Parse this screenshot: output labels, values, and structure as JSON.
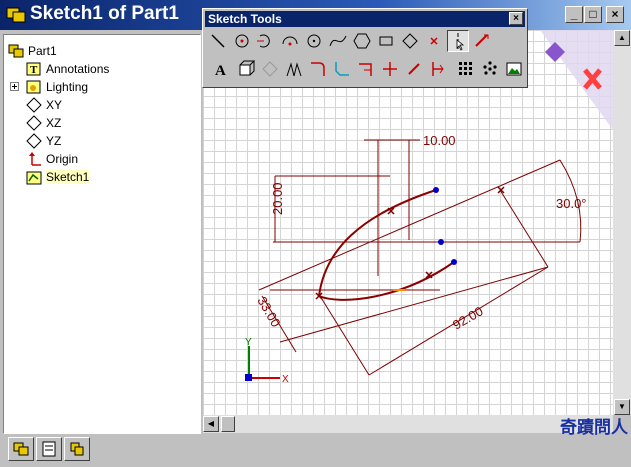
{
  "window": {
    "title": "Sketch1 of Part1",
    "min_label": "_",
    "max_label": "□",
    "close_label": "×"
  },
  "tree": {
    "items": [
      {
        "label": "Part1",
        "icon": "part-icon"
      },
      {
        "label": "Annotations",
        "icon": "annotations-icon"
      },
      {
        "label": "Lighting",
        "icon": "lighting-icon"
      },
      {
        "label": "XY",
        "icon": "plane-icon"
      },
      {
        "label": "XZ",
        "icon": "plane-icon"
      },
      {
        "label": "YZ",
        "icon": "plane-icon"
      },
      {
        "label": "Origin",
        "icon": "origin-icon"
      },
      {
        "label": "Sketch1",
        "icon": "sketch-icon"
      }
    ],
    "expander": "+"
  },
  "toolbar": {
    "title": "Sketch Tools",
    "close_label": "×",
    "row1": [
      "line-tool",
      "circle-center-tool",
      "tangent-arc-tool",
      "three-point-arc-tool",
      "circle-tool",
      "spline-tool",
      "polygon-tool",
      "rectangle-tool",
      "parallelogram-tool",
      "point-tool",
      "centerline-tool",
      "dimension-tool"
    ],
    "row2": [
      "text-tool",
      "convert-entities-tool",
      "offset-tool",
      "mirror-tool",
      "fillet-tool",
      "chamfer-tool",
      "trim-tool",
      "extend-tool",
      "split-tool",
      "construction-tool",
      "linear-pattern-tool",
      "circular-pattern-tool",
      "sketch-picture-tool"
    ]
  },
  "dimensions": {
    "d1": "10.00",
    "d2": "20.00",
    "d3": "30.0°",
    "d4": "33.00",
    "d5": "92.00"
  },
  "triad": {
    "y_label": "Y",
    "x_label": "X"
  },
  "watermark": "奇蹟問人",
  "colors": {
    "sketch": "#8b0000",
    "dim": "#800000",
    "point": "#0000cc",
    "titlebar": "#0a246a"
  }
}
